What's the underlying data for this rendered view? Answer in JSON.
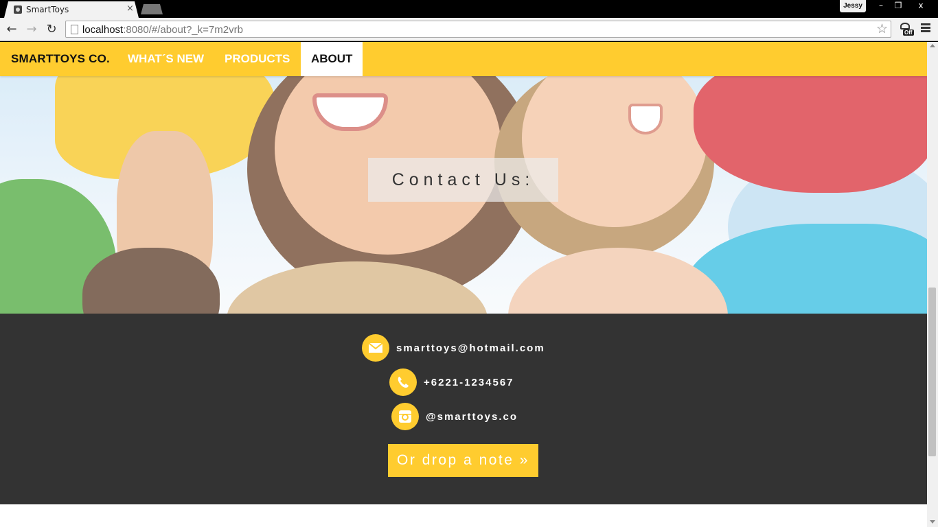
{
  "browser": {
    "tab_title": "SmartToys",
    "tab_close": "×",
    "profile_name": "Jessy",
    "window_minimize": "–",
    "window_restore": "❐",
    "window_close": "x",
    "url_host": "localhost",
    "url_rest": ":8080/#/about?_k=7m2vrb",
    "ext_badge": "Off"
  },
  "site_nav": {
    "brand": "SMARTTOYS CO.",
    "links": [
      "WHAT´S NEW",
      "PRODUCTS"
    ],
    "active": "ABOUT"
  },
  "hero": {
    "heading": "Contact Us:"
  },
  "contact": {
    "email": "smarttoys@hotmail.com",
    "phone": "+6221-1234567",
    "instagram": "@smarttoys.co",
    "cta": "Or drop a note »"
  },
  "colors": {
    "accent_yellow": "#ffcc2f",
    "dark_section": "#333333"
  },
  "icons": [
    "envelope-icon",
    "phone-icon",
    "instagram-icon",
    "star-icon",
    "reload-icon",
    "back-icon",
    "forward-icon",
    "menu-icon"
  ]
}
